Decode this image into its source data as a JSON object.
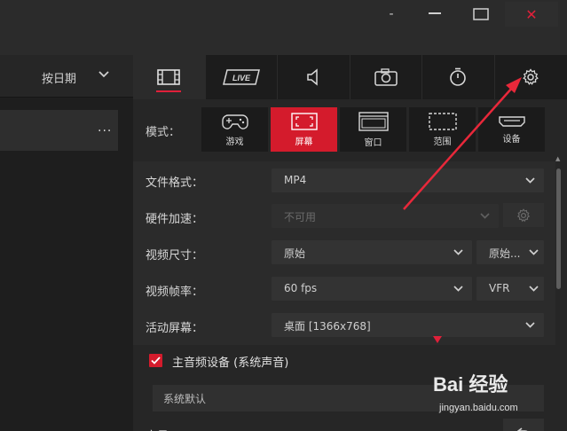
{
  "window": {
    "minimize_glyph": "-",
    "close_glyph": "✕"
  },
  "left_panel": {
    "sort_label": "按日期",
    "row_more": "..."
  },
  "tabs": [
    {
      "name": "video-tab",
      "icon": "film-icon",
      "active": true
    },
    {
      "name": "live-tab",
      "icon": "live-icon",
      "text": "LIVE"
    },
    {
      "name": "audio-tab",
      "icon": "speaker-icon"
    },
    {
      "name": "screenshot-tab",
      "icon": "camera-icon"
    },
    {
      "name": "timer-tab",
      "icon": "stopwatch-icon"
    },
    {
      "name": "settings-tab",
      "icon": "gear-icon"
    }
  ],
  "mode": {
    "label": "模式：",
    "options": [
      {
        "label": "游戏",
        "icon": "gamepad-icon"
      },
      {
        "label": "屏幕",
        "icon": "fullscreen-icon",
        "active": true
      },
      {
        "label": "窗口",
        "icon": "window-icon"
      },
      {
        "label": "范围",
        "icon": "region-icon"
      },
      {
        "label": "设备",
        "icon": "hdmi-icon"
      }
    ]
  },
  "settings": {
    "file_format": {
      "label": "文件格式：",
      "value": "MP4"
    },
    "hw_accel": {
      "label": "硬件加速：",
      "value": "不可用"
    },
    "video_size": {
      "label": "视频尺寸：",
      "value": "原始",
      "value2": "原始..."
    },
    "frame_rate": {
      "label": "视频帧率：",
      "value": "60 fps",
      "value2": "VFR"
    },
    "active_screen": {
      "label": "活动屏幕：",
      "value": "桌面 [1366x768]"
    }
  },
  "audio": {
    "main_label": "主音频设备 (系统声音)",
    "checked": true,
    "device_value": "系统默认",
    "volume_label": "音量"
  },
  "watermark": {
    "brand": "Bai 经验",
    "url": "jingyan.baidu.com"
  },
  "colors": {
    "accent": "#d41b2c",
    "background": "#262626",
    "titlebar": "#2b2b2b"
  }
}
